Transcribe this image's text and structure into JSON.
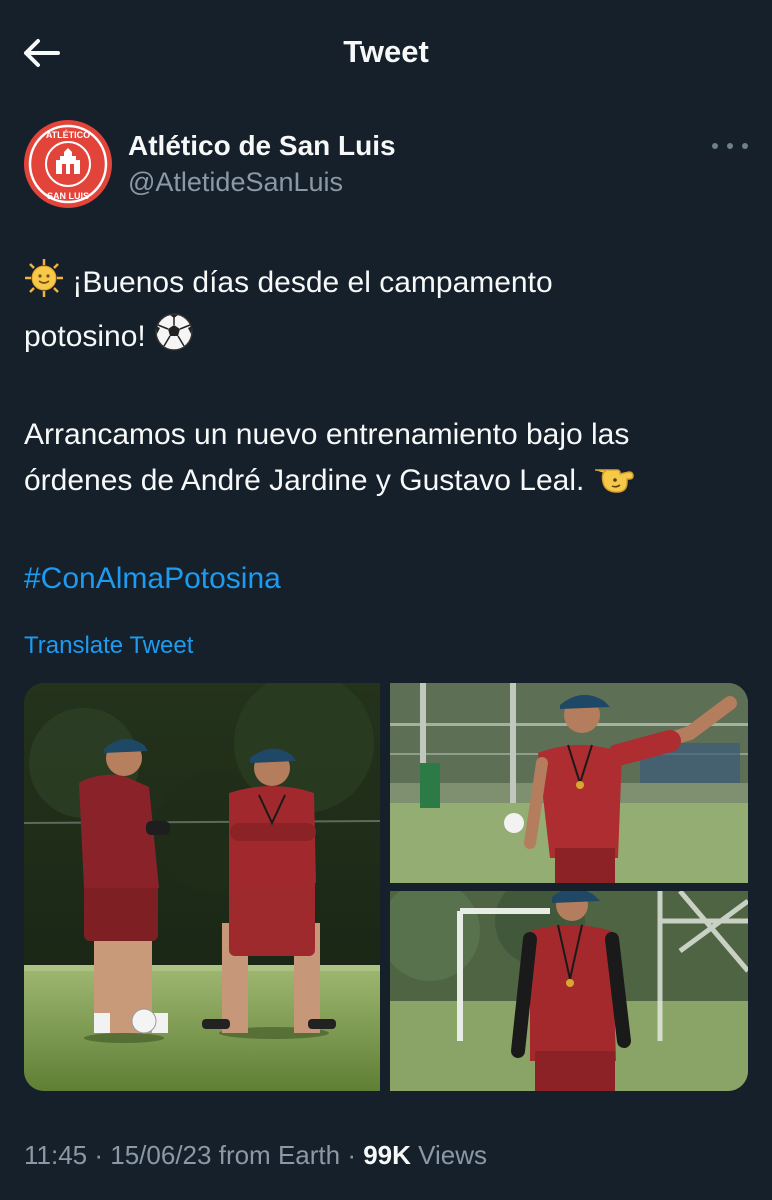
{
  "header": {
    "title": "Tweet",
    "back_icon": "arrow-left-icon"
  },
  "author": {
    "name": "Atlético de San Luis",
    "handle": "@AtletideSanLuis",
    "avatar_text_top": "ATLÉTICO",
    "avatar_text_bottom": "SAN LUIS"
  },
  "tweet": {
    "line1": "¡Buenos días desde el campamento",
    "line2": "potosino!",
    "line3": "Arrancamos un nuevo entrenamiento bajo las",
    "line4": "órdenes de André Jardine y Gustavo Leal.",
    "hashtag": "#ConAlmaPotosina",
    "emojis": [
      "sun-with-face-icon",
      "soccer-ball-icon",
      "pointing-right-icon"
    ]
  },
  "translate_label": "Translate Tweet",
  "meta": {
    "time": "11:45",
    "date": "15/06/23",
    "source": "from Earth",
    "views_count": "99K",
    "views_label": "Views"
  },
  "colors": {
    "background": "#15202b",
    "link": "#1d9bf0",
    "secondary": "#8b98a5",
    "jersey": "#8e2027"
  }
}
